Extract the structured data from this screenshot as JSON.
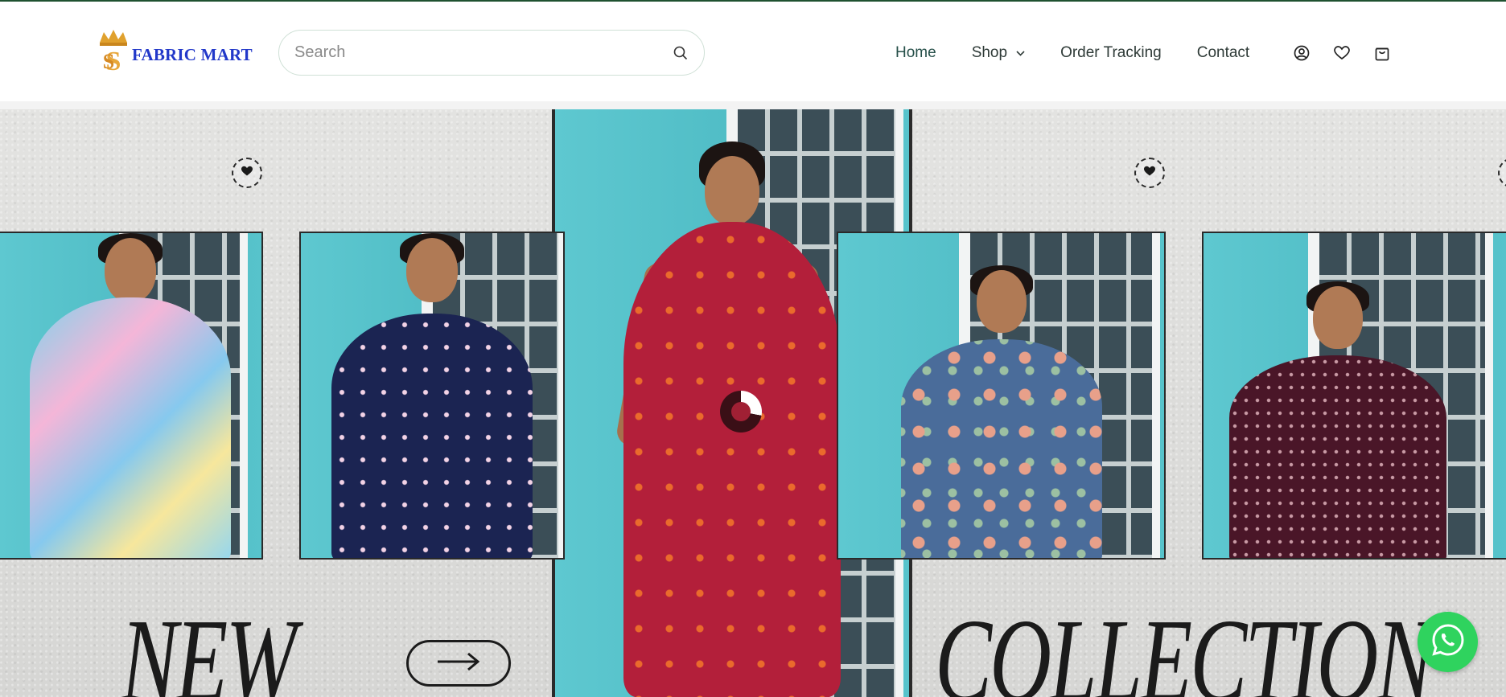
{
  "brand": {
    "name": "FABRIC MART",
    "primary_color": "#2238c9",
    "accent_color": "#e0a12e"
  },
  "search": {
    "placeholder": "Search",
    "value": ""
  },
  "nav": {
    "items": [
      {
        "label": "Home",
        "active": true
      },
      {
        "label": "Shop",
        "has_dropdown": true
      },
      {
        "label": "Order Tracking"
      },
      {
        "label": "Contact"
      }
    ]
  },
  "actions": {
    "icons": [
      "account-icon",
      "wishlist-heart-icon",
      "cart-bag-icon"
    ]
  },
  "hero": {
    "headline_left": "NEW",
    "headline_right": "COLLECTION",
    "loading_indicator": true,
    "dress_colors": [
      "#7fd3ec",
      "#1b2452",
      "#b31f3a",
      "#4a6c9a",
      "#4a1628"
    ]
  },
  "floating": {
    "whatsapp_color": "#2fd35e"
  }
}
